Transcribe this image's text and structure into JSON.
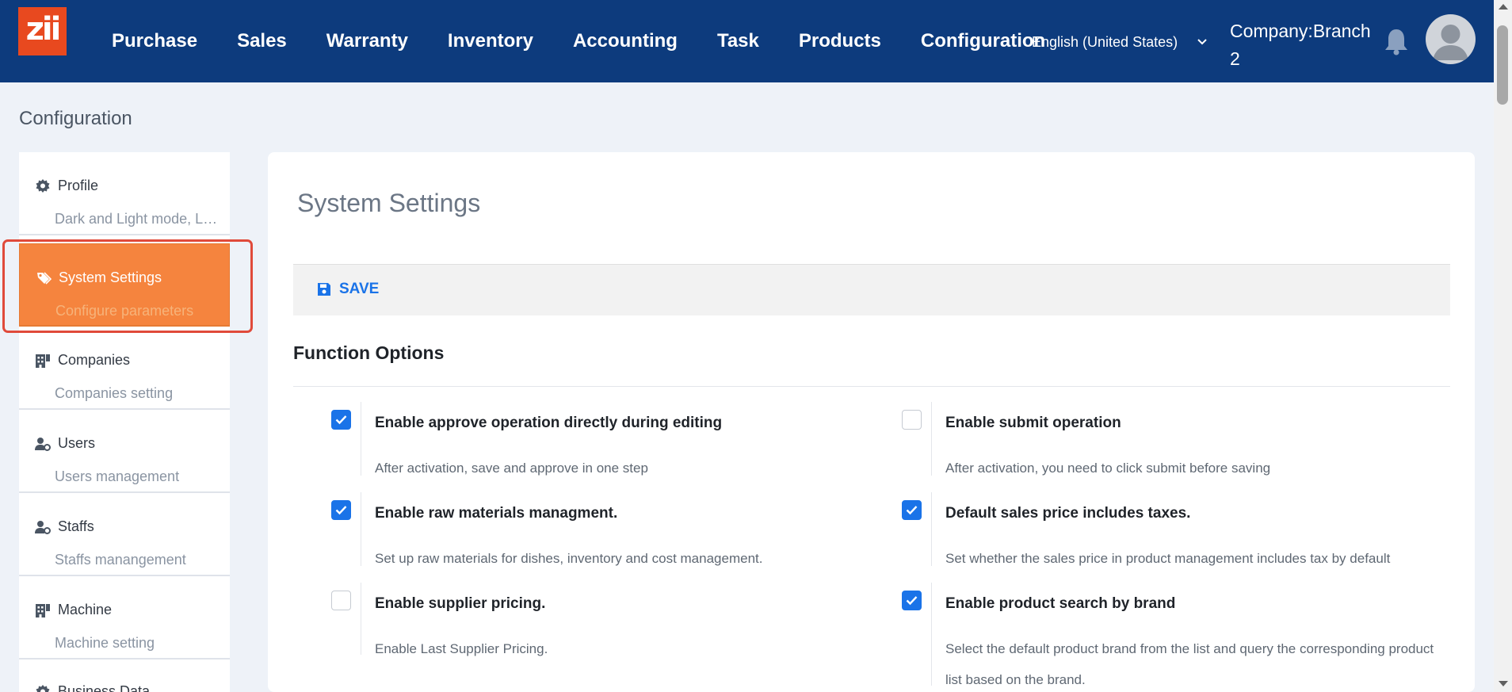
{
  "header": {
    "logo_text": "zii",
    "nav": [
      "Purchase",
      "Sales",
      "Warranty",
      "Inventory",
      "Accounting",
      "Task",
      "Products",
      "Configuration"
    ],
    "language": "English (United States)",
    "company": "Company:Branch 2"
  },
  "breadcrumb": "Configuration",
  "sidebar": {
    "items": [
      {
        "title": "Profile",
        "subtitle": "Dark and Light mode, Language",
        "icon": "gear-icon"
      },
      {
        "title": "System Settings",
        "subtitle": "Configure parameters",
        "icon": "tags-icon"
      },
      {
        "title": "Companies",
        "subtitle": "Companies setting",
        "icon": "building-icon"
      },
      {
        "title": "Users",
        "subtitle": "Users management",
        "icon": "user-cog-icon"
      },
      {
        "title": "Staffs",
        "subtitle": "Staffs manangement",
        "icon": "user-cog-icon"
      },
      {
        "title": "Machine",
        "subtitle": "Machine setting",
        "icon": "building-icon"
      },
      {
        "title": "Business Data",
        "subtitle": "",
        "icon": "gear-icon"
      }
    ]
  },
  "main": {
    "title": "System Settings",
    "save_label": "SAVE",
    "section_title": "Function Options",
    "options": [
      {
        "label": "Enable approve operation directly during editing",
        "desc": "After activation, save and approve in one step",
        "checked": true
      },
      {
        "label": "Enable submit operation",
        "desc": "After activation, you need to click submit before saving",
        "checked": false
      },
      {
        "label": "Enable raw materials managment.",
        "desc": "Set up raw materials for dishes, inventory and cost management.",
        "checked": true
      },
      {
        "label": "Default sales price includes taxes.",
        "desc": "Set whether the sales price in product management includes tax by default",
        "checked": true
      },
      {
        "label": "Enable supplier pricing.",
        "desc": "Enable Last Supplier Pricing.",
        "checked": false
      },
      {
        "label": "Enable product search by brand",
        "desc": "Select the default product brand from the list and query the corresponding product list based on the brand.",
        "checked": true
      }
    ]
  },
  "colors": {
    "header": "#0d3b7d",
    "accent": "#f5843e",
    "primary": "#1a73e8",
    "logo": "#e8491f"
  }
}
